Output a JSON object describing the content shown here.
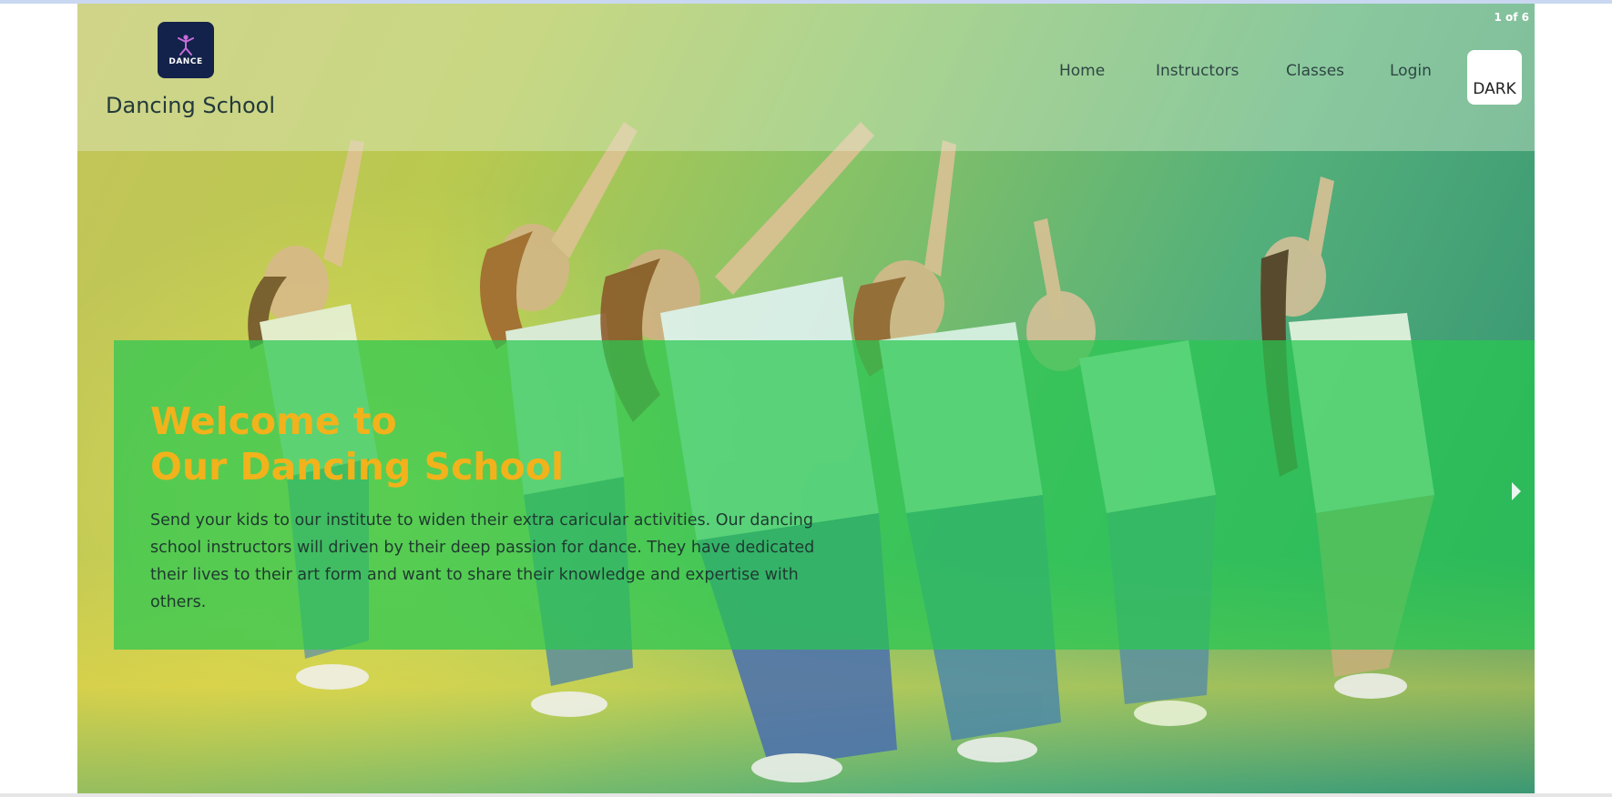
{
  "slider": {
    "counter": "1 of 6",
    "next_icon": "caret-right-icon"
  },
  "header": {
    "logo_text": "DANCE",
    "brand": "Dancing School",
    "nav": [
      "Home",
      "Instructors",
      "Classes",
      "Login"
    ],
    "theme_button": "DARK"
  },
  "hero": {
    "title_line1": "Welcome to",
    "title_line2": "Our Dancing School",
    "text": "Send your kids to our institute to widen their extra caricular activities. Our dancing school instructors will driven by their deep passion for dance. They have dedicated their lives to their art form and want to share their knowledge and expertise with others."
  },
  "colors": {
    "title": "#f2b21b",
    "hero_overlay": "#28c850",
    "logo_bg": "#13224a"
  }
}
